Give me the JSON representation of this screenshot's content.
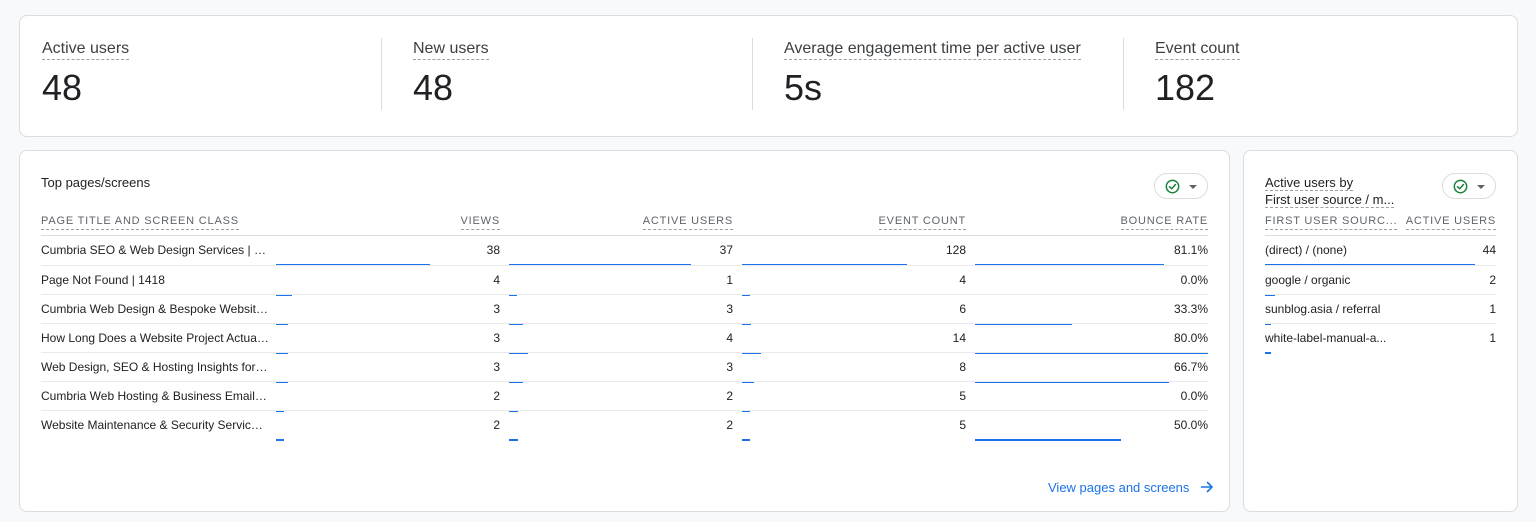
{
  "kpis": [
    {
      "label": "Active users",
      "value": "48"
    },
    {
      "label": "New users",
      "value": "48"
    },
    {
      "label": "Average engagement time per active user",
      "value": "5s"
    },
    {
      "label": "Event count",
      "value": "182"
    }
  ],
  "pages": {
    "title": "Top pages/screens",
    "columns": [
      "PAGE TITLE AND SCREEN CLASS",
      "VIEWS",
      "ACTIVE USERS",
      "EVENT COUNT",
      "BOUNCE RATE"
    ],
    "rows": [
      {
        "name": "Cumbria SEO & Web Design Services | 14...",
        "views": "38",
        "users": "37",
        "events": "128",
        "bounce": "81.1%",
        "bars": [
          0.66,
          0.78,
          0.71,
          0.811
        ]
      },
      {
        "name": "Page Not Found | 1418",
        "views": "4",
        "users": "1",
        "events": "4",
        "bounce": "0.0%",
        "bars": [
          0.07,
          0.02,
          0.02,
          0
        ]
      },
      {
        "name": "Cumbria Web Design & Bespoke Website ...",
        "views": "3",
        "users": "3",
        "events": "6",
        "bounce": "33.3%",
        "bars": [
          0.05,
          0.06,
          0.04,
          0.417
        ]
      },
      {
        "name": "How Long Does a Website Project Actuall...",
        "views": "3",
        "users": "4",
        "events": "14",
        "bounce": "80.0%",
        "bars": [
          0.05,
          0.08,
          0.08,
          1.0
        ]
      },
      {
        "name": "Web Design, SEO & Hosting Insights for C...",
        "views": "3",
        "users": "3",
        "events": "8",
        "bounce": "66.7%",
        "bars": [
          0.05,
          0.06,
          0.05,
          0.834
        ]
      },
      {
        "name": "Cumbria Web Hosting & Business Email S...",
        "views": "2",
        "users": "2",
        "events": "5",
        "bounce": "0.0%",
        "bars": [
          0.035,
          0.04,
          0.03,
          0
        ]
      },
      {
        "name": "Website Maintenance & Security Services...",
        "views": "2",
        "users": "2",
        "events": "5",
        "bounce": "50.0%",
        "bars": [
          0.035,
          0.04,
          0.03,
          0.625
        ]
      }
    ],
    "link_label": "View pages and screens"
  },
  "source": {
    "title_line1": "Active users by",
    "title_line2": "First user source / m...",
    "columns": [
      "FIRST USER SOURC...",
      "ACTIVE USERS"
    ],
    "rows": [
      {
        "name": "(direct) / (none)",
        "value": "44",
        "bar": 0.91
      },
      {
        "name": "google / organic",
        "value": "2",
        "bar": 0.045
      },
      {
        "name": "sunblog.asia / referral",
        "value": "1",
        "bar": 0.025
      },
      {
        "name": "white-label-manual-a...",
        "value": "1",
        "bar": 0.025
      }
    ]
  },
  "colors": {
    "accent": "#1a73e8",
    "check": "#188038"
  }
}
